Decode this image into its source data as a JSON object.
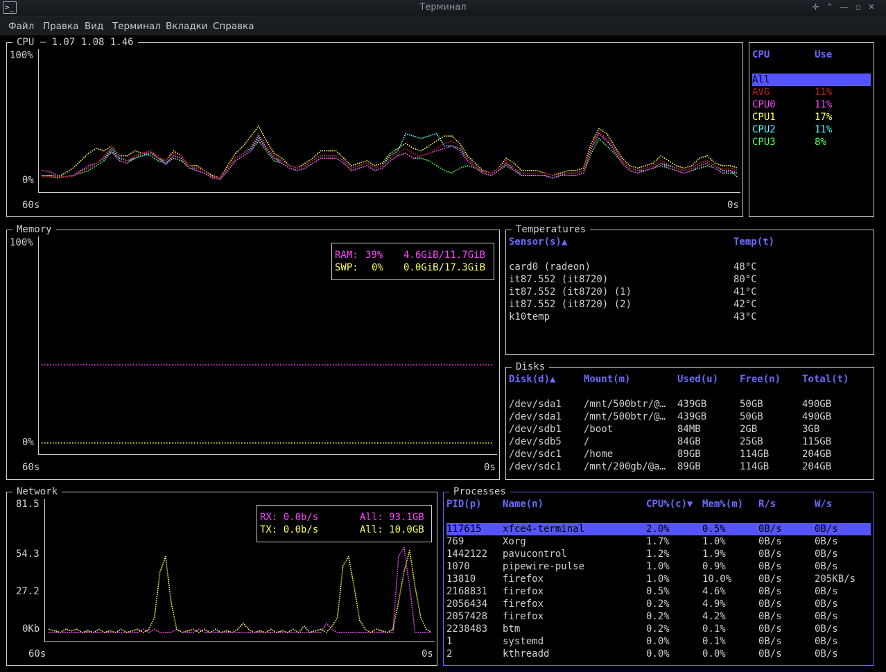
{
  "window": {
    "title": "Терминал",
    "icon": "terminal-icon",
    "controls": [
      "✛",
      "⌃",
      "—",
      "▫",
      "✕"
    ]
  },
  "menu": [
    "Файл",
    "Правка",
    "Вид",
    "Терминал",
    "Вкладки",
    "Справка"
  ],
  "cpu": {
    "title": "CPU — 1.07 1.08 1.46",
    "y_max_label": "100%",
    "y_min_label": "0%",
    "x_left_label": "60s",
    "x_right_label": "0s",
    "table_headers": [
      "CPU",
      "Use"
    ],
    "rows": [
      {
        "name": "All",
        "use": "",
        "color": "#000000",
        "selected": true
      },
      {
        "name": "AVG",
        "use": "11%",
        "color": "#c01818"
      },
      {
        "name": "CPU0",
        "use": "11%",
        "color": "#ff44ff"
      },
      {
        "name": "CPU1",
        "use": "17%",
        "color": "#ffff55"
      },
      {
        "name": "CPU2",
        "use": "11%",
        "color": "#55ffff"
      },
      {
        "name": "CPU3",
        "use": "8%",
        "color": "#55ff55"
      }
    ]
  },
  "memory": {
    "title": "Memory",
    "y_max_label": "100%",
    "y_min_label": "0%",
    "x_left_label": "60s",
    "x_right_label": "0s",
    "ram": {
      "label": "RAM:",
      "percent": "39%",
      "amount": "4.6GiB/11.7GiB",
      "value": 39,
      "color": "#ff44ff"
    },
    "swp": {
      "label": "SWP:",
      "percent": "0%",
      "amount": "0.0GiB/17.3GiB",
      "value": 0,
      "color": "#ffff55"
    }
  },
  "temperatures": {
    "title": "Temperatures",
    "headers": [
      "Sensor(s)▲",
      "Temp(t)"
    ],
    "rows": [
      [
        "card0 (radeon)",
        "48°C"
      ],
      [
        "it87.552 (it8720)",
        "80°C"
      ],
      [
        "it87.552 (it8720) (1)",
        "41°C"
      ],
      [
        "it87.552 (it8720) (2)",
        "42°C"
      ],
      [
        "k10temp",
        "43°C"
      ]
    ]
  },
  "disks": {
    "title": "Disks",
    "headers": [
      "Disk(d)▲",
      "Mount(m)",
      "Used(u)",
      "Free(n)",
      "Total(t)"
    ],
    "rows": [
      [
        "/dev/sda1",
        "/mnt/500btr/@…",
        "439GB",
        "50GB",
        "490GB"
      ],
      [
        "/dev/sda1",
        "/mnt/500btr/@…",
        "439GB",
        "50GB",
        "490GB"
      ],
      [
        "/dev/sdb1",
        "/boot",
        "84MB",
        "2GB",
        "3GB"
      ],
      [
        "/dev/sdb5",
        "/",
        "84GB",
        "25GB",
        "115GB"
      ],
      [
        "/dev/sdc1",
        "/home",
        "89GB",
        "114GB",
        "204GB"
      ],
      [
        "/dev/sdc1",
        "/mnt/200gb/@a…",
        "89GB",
        "114GB",
        "204GB"
      ]
    ]
  },
  "network": {
    "title": "Network",
    "y_labels": [
      "81.5",
      "54.3",
      "27.2",
      "0Kb"
    ],
    "x_left_label": "60s",
    "x_right_label": "0s",
    "rx": {
      "label": "RX: 0.0b/s",
      "total": "All: 93.1GB",
      "color": "#ff44ff"
    },
    "tx": {
      "label": "TX: 0.0b/s",
      "total": "All: 10.0GB",
      "color": "#ffff55"
    }
  },
  "processes": {
    "title": "Processes",
    "headers": [
      "PID(p)",
      "Name(n)",
      "CPU%(c)▼",
      "Mem%(m)",
      "R/s",
      "W/s"
    ],
    "rows": [
      [
        "117615",
        "xfce4-terminal",
        "2.0%",
        "0.5%",
        "0B/s",
        "0B/s"
      ],
      [
        "769",
        "Xorg",
        "1.7%",
        "1.0%",
        "0B/s",
        "0B/s"
      ],
      [
        "1442122",
        "pavucontrol",
        "1.2%",
        "1.9%",
        "0B/s",
        "0B/s"
      ],
      [
        "1070",
        "pipewire-pulse",
        "1.0%",
        "0.9%",
        "0B/s",
        "0B/s"
      ],
      [
        "13810",
        "firefox",
        "1.0%",
        "10.0%",
        "0B/s",
        "205KB/s"
      ],
      [
        "2168831",
        "firefox",
        "0.5%",
        "4.6%",
        "0B/s",
        "0B/s"
      ],
      [
        "2056434",
        "firefox",
        "0.2%",
        "4.9%",
        "0B/s",
        "0B/s"
      ],
      [
        "2057428",
        "firefox",
        "0.2%",
        "4.2%",
        "0B/s",
        "0B/s"
      ],
      [
        "2238483",
        "btm",
        "0.2%",
        "0.1%",
        "0B/s",
        "0B/s"
      ],
      [
        "1",
        "systemd",
        "0.0%",
        "0.1%",
        "0B/s",
        "0B/s"
      ],
      [
        "2",
        "kthreadd",
        "0.0%",
        "0.0%",
        "0B/s",
        "0B/s"
      ]
    ],
    "selected_index": 0
  },
  "chart_data": [
    {
      "type": "line",
      "name": "cpu",
      "ylim": [
        0,
        100
      ],
      "x_range_seconds": [
        60,
        0
      ],
      "series": [
        {
          "name": "AVG",
          "color": "#c01818",
          "values": [
            5,
            5,
            5,
            5,
            5,
            9,
            12,
            16,
            22,
            30,
            22,
            18,
            22,
            24,
            26,
            22,
            18,
            24,
            22,
            14,
            12,
            10,
            5,
            4,
            12,
            20,
            24,
            30,
            40,
            30,
            22,
            18,
            14,
            12,
            14,
            18,
            22,
            22,
            22,
            18,
            12,
            14,
            16,
            12,
            14,
            20,
            24,
            28,
            24,
            22,
            24,
            28,
            32,
            34,
            30,
            20,
            14,
            9,
            8,
            12,
            18,
            12,
            8,
            8,
            8,
            8,
            6,
            7,
            8,
            8,
            10,
            30,
            42,
            36,
            28,
            18,
            12,
            10,
            12,
            14,
            18,
            15,
            12,
            10,
            12,
            16,
            18,
            14,
            11,
            12,
            10
          ]
        },
        {
          "name": "CPU0",
          "color": "#ff44ff",
          "values": [
            10,
            9,
            6,
            5,
            6,
            10,
            14,
            16,
            20,
            25,
            18,
            16,
            22,
            24,
            24,
            20,
            15,
            22,
            20,
            12,
            10,
            8,
            4,
            3,
            10,
            18,
            22,
            26,
            36,
            28,
            20,
            16,
            12,
            10,
            12,
            16,
            20,
            20,
            20,
            16,
            10,
            12,
            14,
            10,
            12,
            18,
            22,
            24,
            20,
            22,
            24,
            26,
            28,
            30,
            26,
            18,
            12,
            8,
            6,
            10,
            16,
            10,
            6,
            6,
            6,
            6,
            4,
            6,
            6,
            6,
            8,
            28,
            40,
            34,
            26,
            16,
            10,
            8,
            10,
            12,
            16,
            12,
            10,
            8,
            10,
            14,
            16,
            12,
            8,
            10,
            8
          ]
        },
        {
          "name": "CPU1",
          "color": "#ffff55",
          "values": [
            6,
            6,
            5,
            8,
            12,
            18,
            24,
            28,
            26,
            30,
            22,
            22,
            26,
            24,
            26,
            20,
            18,
            26,
            22,
            14,
            14,
            10,
            6,
            4,
            14,
            24,
            30,
            38,
            46,
            34,
            24,
            20,
            14,
            12,
            16,
            20,
            26,
            26,
            26,
            20,
            14,
            16,
            18,
            14,
            16,
            24,
            28,
            32,
            28,
            26,
            30,
            34,
            38,
            38,
            32,
            22,
            16,
            10,
            8,
            12,
            20,
            16,
            10,
            10,
            10,
            8,
            6,
            8,
            10,
            10,
            12,
            32,
            44,
            40,
            30,
            20,
            14,
            12,
            14,
            16,
            22,
            18,
            14,
            12,
            14,
            20,
            22,
            16,
            14,
            14,
            12
          ]
        },
        {
          "name": "CPU2",
          "color": "#55ffff",
          "values": [
            6,
            6,
            5,
            5,
            6,
            10,
            12,
            16,
            20,
            28,
            20,
            18,
            20,
            22,
            24,
            20,
            16,
            22,
            20,
            12,
            12,
            10,
            5,
            4,
            12,
            20,
            24,
            28,
            38,
            28,
            20,
            18,
            14,
            12,
            14,
            18,
            22,
            22,
            22,
            18,
            12,
            14,
            16,
            12,
            14,
            22,
            26,
            40,
            38,
            36,
            38,
            40,
            30,
            30,
            28,
            20,
            14,
            8,
            6,
            10,
            16,
            12,
            6,
            6,
            6,
            6,
            4,
            6,
            8,
            8,
            10,
            28,
            40,
            34,
            28,
            18,
            12,
            10,
            10,
            12,
            16,
            14,
            12,
            10,
            12,
            16,
            18,
            14,
            10,
            10,
            4
          ]
        },
        {
          "name": "CPU3",
          "color": "#55ff55",
          "values": [
            5,
            5,
            4,
            5,
            6,
            8,
            10,
            14,
            18,
            26,
            18,
            16,
            20,
            24,
            22,
            18,
            16,
            20,
            18,
            12,
            10,
            8,
            4,
            3,
            10,
            18,
            22,
            26,
            34,
            26,
            18,
            16,
            12,
            10,
            12,
            16,
            20,
            20,
            20,
            16,
            10,
            12,
            14,
            10,
            12,
            18,
            22,
            24,
            20,
            20,
            18,
            14,
            10,
            8,
            12,
            14,
            12,
            8,
            6,
            10,
            14,
            10,
            6,
            6,
            6,
            6,
            4,
            6,
            6,
            6,
            8,
            24,
            36,
            30,
            24,
            16,
            10,
            8,
            10,
            12,
            14,
            12,
            10,
            8,
            10,
            12,
            14,
            12,
            8,
            8,
            8
          ]
        }
      ]
    },
    {
      "type": "line",
      "name": "memory",
      "ylim": [
        0,
        100
      ],
      "x_range_seconds": [
        60,
        0
      ],
      "series": [
        {
          "name": "RAM",
          "color": "#ff44ff",
          "values": [
            39,
            39
          ]
        },
        {
          "name": "SWP",
          "color": "#ffff55",
          "values": [
            0,
            0
          ]
        }
      ]
    },
    {
      "type": "line",
      "name": "network",
      "ylim": [
        0,
        81.5
      ],
      "x_range_seconds": [
        60,
        0
      ],
      "series": [
        {
          "name": "RX",
          "color": "#ff44ff",
          "values": [
            0,
            0,
            0,
            0,
            0,
            0,
            0,
            0,
            0,
            0,
            0,
            0,
            0,
            0,
            0,
            0,
            0,
            2,
            0,
            2,
            0,
            0,
            0,
            2,
            0,
            0,
            0,
            2,
            0,
            0,
            0,
            0,
            0,
            0,
            0,
            0,
            0,
            0,
            0,
            0,
            0,
            0,
            0,
            0,
            0,
            0,
            0,
            0,
            0,
            0,
            6,
            2,
            0,
            0,
            0,
            0,
            0,
            0,
            0,
            0,
            0,
            0,
            0,
            50,
            56,
            30,
            0,
            0,
            0,
            0
          ]
        },
        {
          "name": "TX",
          "color": "#ffff55",
          "values": [
            2,
            1,
            0,
            2,
            1,
            2,
            0,
            1,
            0,
            2,
            0,
            1,
            0,
            2,
            0,
            1,
            2,
            0,
            2,
            10,
            40,
            50,
            20,
            2,
            0,
            1,
            2,
            0,
            2,
            0,
            2,
            0,
            1,
            0,
            2,
            6,
            2,
            0,
            1,
            0,
            2,
            0,
            1,
            0,
            2,
            0,
            4,
            0,
            1,
            2,
            0,
            4,
            10,
            44,
            50,
            30,
            8,
            2,
            0,
            2,
            1,
            0,
            2,
            20,
            40,
            54,
            30,
            10,
            2,
            0
          ]
        }
      ]
    }
  ]
}
